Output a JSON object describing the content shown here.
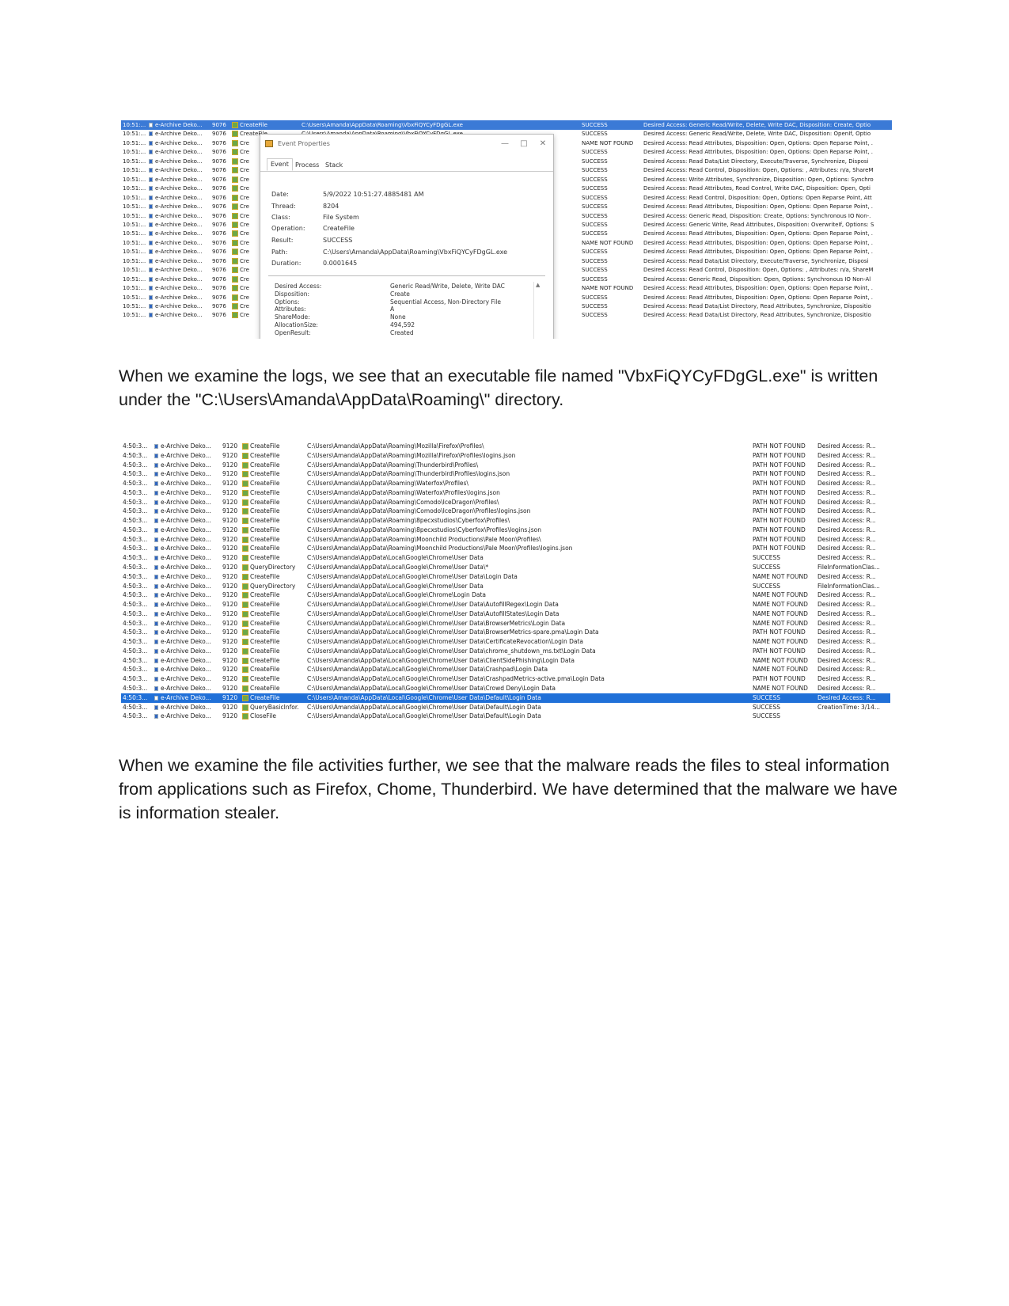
{
  "procmon1": {
    "rows": [
      {
        "time": "10:51:...",
        "process": "e-Archive Deko...",
        "pid": "9076",
        "operation": "CreateFile",
        "path": "C:\\Users\\Amanda\\AppData\\Roaming\\VbxFiQYCyFDgGL.exe",
        "result": "SUCCESS",
        "detail": "Desired Access: Generic Read/Write, Delete, Write DAC, Disposition: Create, Optio",
        "selected": true
      },
      {
        "time": "10:51:...",
        "process": "e-Archive Deko...",
        "pid": "9076",
        "operation": "CreateFile",
        "path": "C:\\Users\\Amanda\\AppData\\Roaming\\VbxFiQYCyFDgGL.exe",
        "result": "SUCCESS",
        "detail": "Desired Access: Generic Read/Write, Delete, Write DAC, Disposition: OpenIf, Optio"
      },
      {
        "time": "10:51:...",
        "process": "e-Archive Deko...",
        "pid": "9076",
        "operation": "Cre",
        "path": "",
        "result": "NAME NOT FOUND",
        "detail": "Desired Access: Read Attributes, Disposition: Open, Options: Open Reparse Point, ."
      },
      {
        "time": "10:51:...",
        "process": "e-Archive Deko...",
        "pid": "9076",
        "operation": "Cre",
        "path": "",
        "result": "SUCCESS",
        "detail": "Desired Access: Read Attributes, Disposition: Open, Options: Open Reparse Point, ."
      },
      {
        "time": "10:51:...",
        "process": "e-Archive Deko...",
        "pid": "9076",
        "operation": "Cre",
        "path": "",
        "result": "SUCCESS",
        "detail": "Desired Access: Read Data/List Directory, Execute/Traverse, Synchronize, Disposi"
      },
      {
        "time": "10:51:...",
        "process": "e-Archive Deko...",
        "pid": "9076",
        "operation": "Cre",
        "path": "",
        "result": "SUCCESS",
        "detail": "Desired Access: Read Control, Disposition: Open, Options: , Attributes: n/a, ShareM"
      },
      {
        "time": "10:51:...",
        "process": "e-Archive Deko...",
        "pid": "9076",
        "operation": "Cre",
        "path": "",
        "result": "SUCCESS",
        "detail": "Desired Access: Write Attributes, Synchronize, Disposition: Open, Options: Synchro"
      },
      {
        "time": "10:51:...",
        "process": "e-Archive Deko...",
        "pid": "9076",
        "operation": "Cre",
        "path": "",
        "result": "SUCCESS",
        "detail": "Desired Access: Read Attributes, Read Control, Write DAC, Disposition: Open, Opti"
      },
      {
        "time": "10:51:...",
        "process": "e-Archive Deko...",
        "pid": "9076",
        "operation": "Cre",
        "path": "",
        "result": "SUCCESS",
        "detail": "Desired Access: Read Control, Disposition: Open, Options: Open Reparse Point, Att"
      },
      {
        "time": "10:51:...",
        "process": "e-Archive Deko...",
        "pid": "9076",
        "operation": "Cre",
        "path": "",
        "result": "SUCCESS",
        "detail": "Desired Access: Read Attributes, Disposition: Open, Options: Open Reparse Point, ."
      },
      {
        "time": "10:51:...",
        "process": "e-Archive Deko...",
        "pid": "9076",
        "operation": "Cre",
        "path": "",
        "result": "SUCCESS",
        "detail": "Desired Access: Generic Read, Disposition: Create, Options: Synchronous IO Non-."
      },
      {
        "time": "10:51:...",
        "process": "e-Archive Deko...",
        "pid": "9076",
        "operation": "Cre",
        "path": "",
        "result": "SUCCESS",
        "detail": "Desired Access: Generic Write, Read Attributes, Disposition: OverwriteIf, Options: S"
      },
      {
        "time": "10:51:...",
        "process": "e-Archive Deko...",
        "pid": "9076",
        "operation": "Cre",
        "path": "",
        "result": "SUCCESS",
        "detail": "Desired Access: Read Attributes, Disposition: Open, Options: Open Reparse Point, ."
      },
      {
        "time": "10:51:...",
        "process": "e-Archive Deko...",
        "pid": "9076",
        "operation": "Cre",
        "path": "",
        "result": "NAME NOT FOUND",
        "detail": "Desired Access: Read Attributes, Disposition: Open, Options: Open Reparse Point, ."
      },
      {
        "time": "10:51:...",
        "process": "e-Archive Deko...",
        "pid": "9076",
        "operation": "Cre",
        "path": "",
        "result": "SUCCESS",
        "detail": "Desired Access: Read Attributes, Disposition: Open, Options: Open Reparse Point, ."
      },
      {
        "time": "10:51:...",
        "process": "e-Archive Deko...",
        "pid": "9076",
        "operation": "Cre",
        "path": "",
        "result": "SUCCESS",
        "detail": "Desired Access: Read Data/List Directory, Execute/Traverse, Synchronize, Disposi"
      },
      {
        "time": "10:51:...",
        "process": "e-Archive Deko...",
        "pid": "9076",
        "operation": "Cre",
        "path": "",
        "result": "SUCCESS",
        "detail": "Desired Access: Read Control, Disposition: Open, Options: , Attributes: n/a, ShareM"
      },
      {
        "time": "10:51:...",
        "process": "e-Archive Deko...",
        "pid": "9076",
        "operation": "Cre",
        "path": "",
        "result": "SUCCESS",
        "detail": "Desired Access: Generic Read, Disposition: Open, Options: Synchronous IO Non-Al"
      },
      {
        "time": "10:51:...",
        "process": "e-Archive Deko...",
        "pid": "9076",
        "operation": "Cre",
        "path": "",
        "result": "NAME NOT FOUND",
        "detail": "Desired Access: Read Attributes, Disposition: Open, Options: Open Reparse Point, ."
      },
      {
        "time": "10:51:...",
        "process": "e-Archive Deko...",
        "pid": "9076",
        "operation": "Cre",
        "path": "",
        "result": "SUCCESS",
        "detail": "Desired Access: Read Attributes, Disposition: Open, Options: Open Reparse Point, ."
      },
      {
        "time": "10:51:...",
        "process": "e-Archive Deko...",
        "pid": "9076",
        "operation": "Cre",
        "path": "",
        "result": "SUCCESS",
        "detail": "Desired Access: Read Data/List Directory, Read Attributes, Synchronize, Dispositio"
      },
      {
        "time": "10:51:...",
        "process": "e-Archive Deko...",
        "pid": "9076",
        "operation": "Cre",
        "path": "",
        "result": "SUCCESS",
        "detail": "Desired Access: Read Data/List Directory, Read Attributes, Synchronize, Dispositio"
      }
    ],
    "dialog": {
      "title": "Event Properties",
      "tabs": [
        "Event",
        "Process",
        "Stack"
      ],
      "fields": [
        {
          "label": "Date:",
          "value": "5/9/2022 10:51:27.4885481 AM"
        },
        {
          "label": "Thread:",
          "value": "8204"
        },
        {
          "label": "Class:",
          "value": "File System"
        },
        {
          "label": "Operation:",
          "value": "CreateFile"
        },
        {
          "label": "Result:",
          "value": "SUCCESS"
        },
        {
          "label": "Path:",
          "value": "C:\\Users\\Amanda\\AppData\\Roaming\\VbxFiQYCyFDgGL.exe"
        },
        {
          "label": "Duration:",
          "value": "0.0001645"
        }
      ],
      "details": [
        {
          "label": "Desired Access:",
          "value": "Generic Read/Write, Delete, Write DAC"
        },
        {
          "label": "Disposition:",
          "value": "Create"
        },
        {
          "label": "Options:",
          "value": "Sequential Access, Non-Directory File"
        },
        {
          "label": "Attributes:",
          "value": "A"
        },
        {
          "label": "ShareMode:",
          "value": "None"
        },
        {
          "label": "AllocationSize:",
          "value": "494,592"
        },
        {
          "label": "OpenResult:",
          "value": "Created"
        }
      ]
    }
  },
  "paragraph1": "When we examine the logs, we see that an executable file named \"VbxFiQYCyFDgGL.exe\" is written under the \"C:\\Users\\Amanda\\AppData\\Roaming\\\" directory.",
  "procmon2": {
    "rows": [
      {
        "time": "4:50:3...",
        "process": "e-Archive Deko...",
        "pid": "9120",
        "operation": "CreateFile",
        "path": "C:\\Users\\Amanda\\AppData\\Roaming\\Mozilla\\Firefox\\Profiles\\",
        "result": "PATH NOT FOUND",
        "detail": "Desired Access: R..."
      },
      {
        "time": "4:50:3...",
        "process": "e-Archive Deko...",
        "pid": "9120",
        "operation": "CreateFile",
        "path": "C:\\Users\\Amanda\\AppData\\Roaming\\Mozilla\\Firefox\\Profiles\\logins.json",
        "result": "PATH NOT FOUND",
        "detail": "Desired Access: R..."
      },
      {
        "time": "4:50:3...",
        "process": "e-Archive Deko...",
        "pid": "9120",
        "operation": "CreateFile",
        "path": "C:\\Users\\Amanda\\AppData\\Roaming\\Thunderbird\\Profiles\\",
        "result": "PATH NOT FOUND",
        "detail": "Desired Access: R..."
      },
      {
        "time": "4:50:3...",
        "process": "e-Archive Deko...",
        "pid": "9120",
        "operation": "CreateFile",
        "path": "C:\\Users\\Amanda\\AppData\\Roaming\\Thunderbird\\Profiles\\logins.json",
        "result": "PATH NOT FOUND",
        "detail": "Desired Access: R..."
      },
      {
        "time": "4:50:3...",
        "process": "e-Archive Deko...",
        "pid": "9120",
        "operation": "CreateFile",
        "path": "C:\\Users\\Amanda\\AppData\\Roaming\\Waterfox\\Profiles\\",
        "result": "PATH NOT FOUND",
        "detail": "Desired Access: R..."
      },
      {
        "time": "4:50:3...",
        "process": "e-Archive Deko...",
        "pid": "9120",
        "operation": "CreateFile",
        "path": "C:\\Users\\Amanda\\AppData\\Roaming\\Waterfox\\Profiles\\logins.json",
        "result": "PATH NOT FOUND",
        "detail": "Desired Access: R..."
      },
      {
        "time": "4:50:3...",
        "process": "e-Archive Deko...",
        "pid": "9120",
        "operation": "CreateFile",
        "path": "C:\\Users\\Amanda\\AppData\\Roaming\\Comodo\\IceDragon\\Profiles\\",
        "result": "PATH NOT FOUND",
        "detail": "Desired Access: R..."
      },
      {
        "time": "4:50:3...",
        "process": "e-Archive Deko...",
        "pid": "9120",
        "operation": "CreateFile",
        "path": "C:\\Users\\Amanda\\AppData\\Roaming\\Comodo\\IceDragon\\Profiles\\logins.json",
        "result": "PATH NOT FOUND",
        "detail": "Desired Access: R..."
      },
      {
        "time": "4:50:3...",
        "process": "e-Archive Deko...",
        "pid": "9120",
        "operation": "CreateFile",
        "path": "C:\\Users\\Amanda\\AppData\\Roaming\\8pecxstudios\\Cyberfox\\Profiles\\",
        "result": "PATH NOT FOUND",
        "detail": "Desired Access: R..."
      },
      {
        "time": "4:50:3...",
        "process": "e-Archive Deko...",
        "pid": "9120",
        "operation": "CreateFile",
        "path": "C:\\Users\\Amanda\\AppData\\Roaming\\8pecxstudios\\Cyberfox\\Profiles\\logins.json",
        "result": "PATH NOT FOUND",
        "detail": "Desired Access: R..."
      },
      {
        "time": "4:50:3...",
        "process": "e-Archive Deko...",
        "pid": "9120",
        "operation": "CreateFile",
        "path": "C:\\Users\\Amanda\\AppData\\Roaming\\Moonchild Productions\\Pale Moon\\Profiles\\",
        "result": "PATH NOT FOUND",
        "detail": "Desired Access: R..."
      },
      {
        "time": "4:50:3...",
        "process": "e-Archive Deko...",
        "pid": "9120",
        "operation": "CreateFile",
        "path": "C:\\Users\\Amanda\\AppData\\Roaming\\Moonchild Productions\\Pale Moon\\Profiles\\logins.json",
        "result": "PATH NOT FOUND",
        "detail": "Desired Access: R..."
      },
      {
        "time": "4:50:3...",
        "process": "e-Archive Deko...",
        "pid": "9120",
        "operation": "CreateFile",
        "path": "C:\\Users\\Amanda\\AppData\\Local\\Google\\Chrome\\User Data",
        "result": "SUCCESS",
        "detail": "Desired Access: R..."
      },
      {
        "time": "4:50:3...",
        "process": "e-Archive Deko...",
        "pid": "9120",
        "operation": "QueryDirectory",
        "path": "C:\\Users\\Amanda\\AppData\\Local\\Google\\Chrome\\User Data\\*",
        "result": "SUCCESS",
        "detail": "FileInformationClas..."
      },
      {
        "time": "4:50:3...",
        "process": "e-Archive Deko...",
        "pid": "9120",
        "operation": "CreateFile",
        "path": "C:\\Users\\Amanda\\AppData\\Local\\Google\\Chrome\\User Data\\Login Data",
        "result": "NAME NOT FOUND",
        "detail": "Desired Access: R..."
      },
      {
        "time": "4:50:3...",
        "process": "e-Archive Deko...",
        "pid": "9120",
        "operation": "QueryDirectory",
        "path": "C:\\Users\\Amanda\\AppData\\Local\\Google\\Chrome\\User Data",
        "result": "SUCCESS",
        "detail": "FileInformationClas..."
      },
      {
        "time": "4:50:3...",
        "process": "e-Archive Deko...",
        "pid": "9120",
        "operation": "CreateFile",
        "path": "C:\\Users\\Amanda\\AppData\\Local\\Google\\Chrome\\Login Data",
        "result": "NAME NOT FOUND",
        "detail": "Desired Access: R..."
      },
      {
        "time": "4:50:3...",
        "process": "e-Archive Deko...",
        "pid": "9120",
        "operation": "CreateFile",
        "path": "C:\\Users\\Amanda\\AppData\\Local\\Google\\Chrome\\User Data\\AutofillRegex\\Login Data",
        "result": "NAME NOT FOUND",
        "detail": "Desired Access: R..."
      },
      {
        "time": "4:50:3...",
        "process": "e-Archive Deko...",
        "pid": "9120",
        "operation": "CreateFile",
        "path": "C:\\Users\\Amanda\\AppData\\Local\\Google\\Chrome\\User Data\\AutofillStates\\Login Data",
        "result": "NAME NOT FOUND",
        "detail": "Desired Access: R..."
      },
      {
        "time": "4:50:3...",
        "process": "e-Archive Deko...",
        "pid": "9120",
        "operation": "CreateFile",
        "path": "C:\\Users\\Amanda\\AppData\\Local\\Google\\Chrome\\User Data\\BrowserMetrics\\Login Data",
        "result": "NAME NOT FOUND",
        "detail": "Desired Access: R..."
      },
      {
        "time": "4:50:3...",
        "process": "e-Archive Deko...",
        "pid": "9120",
        "operation": "CreateFile",
        "path": "C:\\Users\\Amanda\\AppData\\Local\\Google\\Chrome\\User Data\\BrowserMetrics-spare.pma\\Login Data",
        "result": "PATH NOT FOUND",
        "detail": "Desired Access: R..."
      },
      {
        "time": "4:50:3...",
        "process": "e-Archive Deko...",
        "pid": "9120",
        "operation": "CreateFile",
        "path": "C:\\Users\\Amanda\\AppData\\Local\\Google\\Chrome\\User Data\\CertificateRevocation\\Login Data",
        "result": "NAME NOT FOUND",
        "detail": "Desired Access: R..."
      },
      {
        "time": "4:50:3...",
        "process": "e-Archive Deko...",
        "pid": "9120",
        "operation": "CreateFile",
        "path": "C:\\Users\\Amanda\\AppData\\Local\\Google\\Chrome\\User Data\\chrome_shutdown_ms.txt\\Login Data",
        "result": "PATH NOT FOUND",
        "detail": "Desired Access: R..."
      },
      {
        "time": "4:50:3...",
        "process": "e-Archive Deko...",
        "pid": "9120",
        "operation": "CreateFile",
        "path": "C:\\Users\\Amanda\\AppData\\Local\\Google\\Chrome\\User Data\\ClientSidePhishing\\Login Data",
        "result": "NAME NOT FOUND",
        "detail": "Desired Access: R..."
      },
      {
        "time": "4:50:3...",
        "process": "e-Archive Deko...",
        "pid": "9120",
        "operation": "CreateFile",
        "path": "C:\\Users\\Amanda\\AppData\\Local\\Google\\Chrome\\User Data\\Crashpad\\Login Data",
        "result": "NAME NOT FOUND",
        "detail": "Desired Access: R..."
      },
      {
        "time": "4:50:3...",
        "process": "e-Archive Deko...",
        "pid": "9120",
        "operation": "CreateFile",
        "path": "C:\\Users\\Amanda\\AppData\\Local\\Google\\Chrome\\User Data\\CrashpadMetrics-active.pma\\Login Data",
        "result": "PATH NOT FOUND",
        "detail": "Desired Access: R..."
      },
      {
        "time": "4:50:3...",
        "process": "e-Archive Deko...",
        "pid": "9120",
        "operation": "CreateFile",
        "path": "C:\\Users\\Amanda\\AppData\\Local\\Google\\Chrome\\User Data\\Crowd Deny\\Login Data",
        "result": "NAME NOT FOUND",
        "detail": "Desired Access: R..."
      },
      {
        "time": "4:50:3...",
        "process": "e-Archive Deko...",
        "pid": "9120",
        "operation": "CreateFile",
        "path": "C:\\Users\\Amanda\\AppData\\Local\\Google\\Chrome\\User Data\\Default\\Login Data",
        "result": "SUCCESS",
        "detail": "Desired Access: R...",
        "selected": true
      },
      {
        "time": "4:50:3...",
        "process": "e-Archive Deko...",
        "pid": "9120",
        "operation": "QueryBasicInfor...",
        "path": "C:\\Users\\Amanda\\AppData\\Local\\Google\\Chrome\\User Data\\Default\\Login Data",
        "result": "SUCCESS",
        "detail": "CreationTime: 3/14..."
      },
      {
        "time": "4:50:3...",
        "process": "e-Archive Deko...",
        "pid": "9120",
        "operation": "CloseFile",
        "path": "C:\\Users\\Amanda\\AppData\\Local\\Google\\Chrome\\User Data\\Default\\Login Data",
        "result": "SUCCESS",
        "detail": ""
      }
    ]
  },
  "paragraph2": "When we examine the file activities further, we see that the malware reads the files to steal information from applications such as Firefox, Chome, Thunderbird. We have determined that the malware we have is information stealer.",
  "colors": {
    "selection": "#3b7ad6",
    "selection2": "#2070d8"
  }
}
